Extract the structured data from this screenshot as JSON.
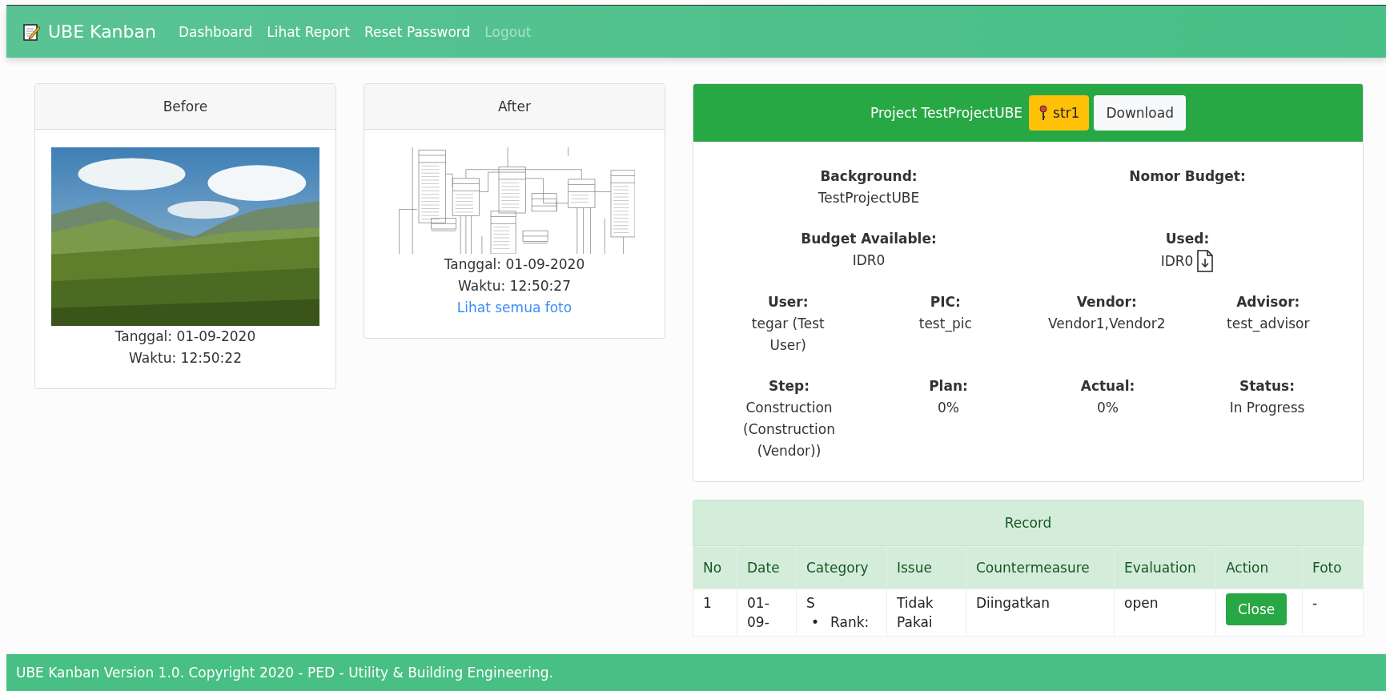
{
  "nav": {
    "brand": "UBE Kanban",
    "links": [
      {
        "label": "Dashboard",
        "disabled": false
      },
      {
        "label": "Lihat Report",
        "disabled": false
      },
      {
        "label": "Reset Password",
        "disabled": false
      },
      {
        "label": "Logout",
        "disabled": true
      }
    ]
  },
  "photos": [
    {
      "title": "Before",
      "kind": "picture",
      "date": "Tanggal: 01-09-2020",
      "time": "Waktu: 12:50:22"
    },
    {
      "title": "After",
      "kind": "picture",
      "date": "Tanggal: 01-09-2020",
      "time": "Waktu: 12:50:27",
      "link": "Lihat semua foto"
    }
  ],
  "project": {
    "title": "Project TestProjectUBE",
    "key": "str1",
    "download": "Download",
    "rows": [
      [
        {
          "label": "Background:",
          "value": "TestProjectUBE",
          "kind": "text"
        },
        {
          "label": "Nomor Budget:",
          "kind": "text"
        }
      ],
      [
        {
          "label": "Budget Available:",
          "value": "IDR0",
          "kind": "text"
        },
        {
          "label": "Used:",
          "value": "IDR0",
          "kind": "file"
        }
      ],
      [
        {
          "label": "User:",
          "value": "tegar (Test User)",
          "kind": "text"
        },
        {
          "label": "PIC:",
          "value": "test_pic",
          "kind": "text"
        },
        {
          "label": "Vendor:",
          "value": "Vendor1,Vendor2",
          "kind": "text"
        },
        {
          "label": "Advisor:",
          "value": "test_advisor",
          "kind": "text"
        }
      ],
      [
        {
          "label": "Step:",
          "value": "Construction (Construction (Vendor))",
          "kind": "text"
        },
        {
          "label": "Plan:",
          "value": "0%",
          "kind": "text"
        },
        {
          "label": "Actual:",
          "value": "0%",
          "kind": "text"
        },
        {
          "label": "Status:",
          "value": "In Progress",
          "kind": "text"
        }
      ]
    ]
  },
  "record": {
    "title": "Record",
    "columns": [
      "No",
      "Date",
      "Category",
      "Issue",
      "Countermeasure",
      "Evaluation",
      "Action",
      "Foto"
    ],
    "rows": [
      {
        "no": "1",
        "date": "01-09-",
        "category": "S",
        "category_items": [
          {
            "marker": "•",
            "text": "Rank:"
          }
        ],
        "issue": "Tidak Pakai",
        "countermeasure": "Diingatkan",
        "evaluation": "open",
        "action": "Close",
        "foto": "-"
      }
    ]
  },
  "footer": "UBE Kanban Version 1.0. Copyright 2020 - PED - Utility & Building Engineering."
}
